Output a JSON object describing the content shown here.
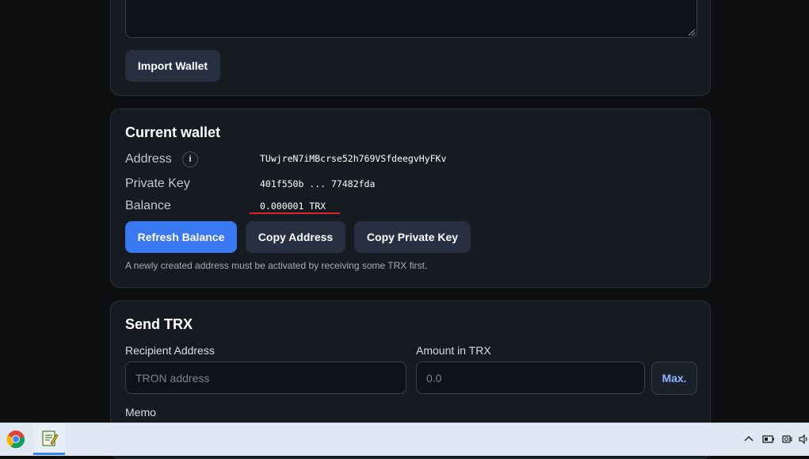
{
  "import_section": {
    "import_button": "Import Wallet"
  },
  "current_wallet": {
    "title": "Current wallet",
    "address_label": "Address",
    "address_info_icon": "info-icon",
    "address_value": "TUwjreN7iMBcrse52h769VSfdeegvHyFKv",
    "private_key_label": "Private Key",
    "private_key_value": "401f550b ... 77482fda",
    "balance_label": "Balance",
    "balance_value": "0.000001 TRX",
    "refresh_button": "Refresh Balance",
    "copy_address_button": "Copy Address",
    "copy_private_key_button": "Copy Private Key",
    "note": "A newly created address must be activated by receiving some TRX first."
  },
  "send_trx": {
    "title": "Send TRX",
    "recipient_label": "Recipient Address",
    "recipient_placeholder": "TRON address",
    "amount_label": "Amount in TRX",
    "amount_placeholder": "0.0",
    "max_button": "Max.",
    "memo_label": "Memo"
  },
  "taskbar": {
    "apps": [
      "chrome-icon",
      "text-editor-icon"
    ],
    "tray_icons": [
      "chevron-up-icon",
      "battery-icon",
      "camera-icon",
      "speaker-icon"
    ]
  },
  "colors": {
    "primary_button": "#3a78f2",
    "balance_underline": "#e0202a"
  }
}
